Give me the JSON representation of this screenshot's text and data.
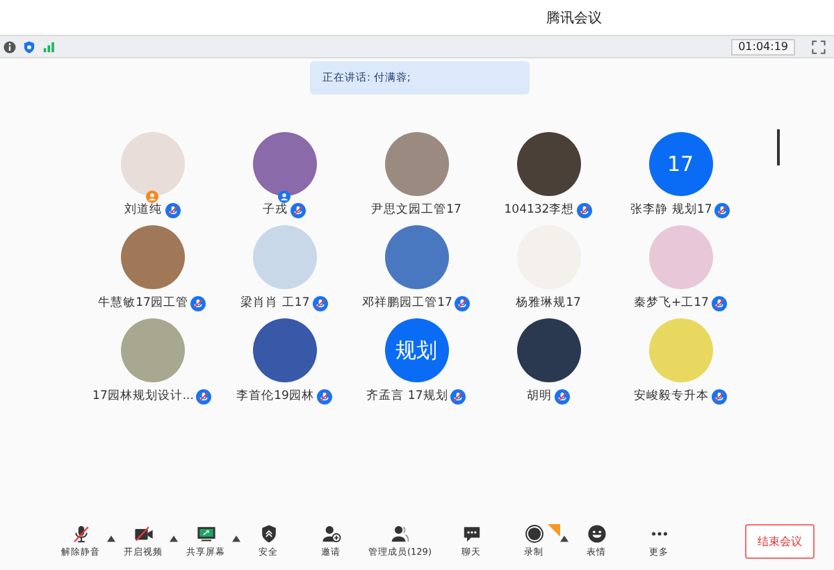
{
  "window": {
    "title": "腾讯会议"
  },
  "status_bar": {
    "timer": "01:04:19"
  },
  "speaking": {
    "text": "正在讲话: 付满蓉;"
  },
  "participants": [
    {
      "name": "刘道纯",
      "photo": true,
      "mic_muted": true,
      "host": true,
      "cohost": false
    },
    {
      "name": "子戎",
      "photo": true,
      "mic_muted": true,
      "host": false,
      "cohost": true
    },
    {
      "name": "尹思文园工管17",
      "photo": true,
      "mic_muted": false,
      "host": false,
      "cohost": false
    },
    {
      "name": "104132李想",
      "photo": true,
      "mic_muted": true,
      "host": false,
      "cohost": false
    },
    {
      "name": "张李静 规划17",
      "photo": false,
      "avatar_text": "17",
      "mic_muted": true,
      "host": false,
      "cohost": false
    },
    {
      "name": "牛慧敏17园工管",
      "photo": true,
      "mic_muted": true,
      "host": false,
      "cohost": false
    },
    {
      "name": "梁肖肖 工17",
      "photo": true,
      "mic_muted": true,
      "host": false,
      "cohost": false
    },
    {
      "name": "邓祥鹏园工管17",
      "photo": true,
      "mic_muted": true,
      "host": false,
      "cohost": false
    },
    {
      "name": "杨雅琳规17",
      "photo": true,
      "mic_muted": false,
      "host": false,
      "cohost": false
    },
    {
      "name": "秦梦飞+工17",
      "photo": true,
      "mic_muted": true,
      "host": false,
      "cohost": false
    },
    {
      "name": "17园林规划设计...",
      "photo": true,
      "mic_muted": true,
      "host": false,
      "cohost": false
    },
    {
      "name": "李首伦19园林",
      "photo": true,
      "mic_muted": true,
      "host": false,
      "cohost": false
    },
    {
      "name": "齐孟言 17规划",
      "photo": false,
      "avatar_text": "规划",
      "mic_muted": true,
      "host": false,
      "cohost": false
    },
    {
      "name": "胡明",
      "photo": true,
      "mic_muted": true,
      "host": false,
      "cohost": false
    },
    {
      "name": "安峻毅专升本",
      "photo": true,
      "mic_muted": true,
      "host": false,
      "cohost": false
    }
  ],
  "toolbar": [
    {
      "label": "解除静音",
      "kind": "mic",
      "has_menu": true
    },
    {
      "label": "开启视频",
      "kind": "video",
      "has_menu": true
    },
    {
      "label": "共享屏幕",
      "kind": "share",
      "has_menu": true
    },
    {
      "label": "安全",
      "kind": "shield",
      "has_menu": false
    },
    {
      "label": "邀请",
      "kind": "invite",
      "has_menu": false
    },
    {
      "label": "管理成员(129)",
      "kind": "members",
      "has_menu": false
    },
    {
      "label": "聊天",
      "kind": "chat",
      "has_menu": false
    },
    {
      "label": "录制",
      "kind": "record",
      "has_menu": true
    },
    {
      "label": "表情",
      "kind": "emoji",
      "has_menu": false
    },
    {
      "label": "更多",
      "kind": "more",
      "has_menu": false
    }
  ],
  "end_button": {
    "label": "结束会议"
  }
}
